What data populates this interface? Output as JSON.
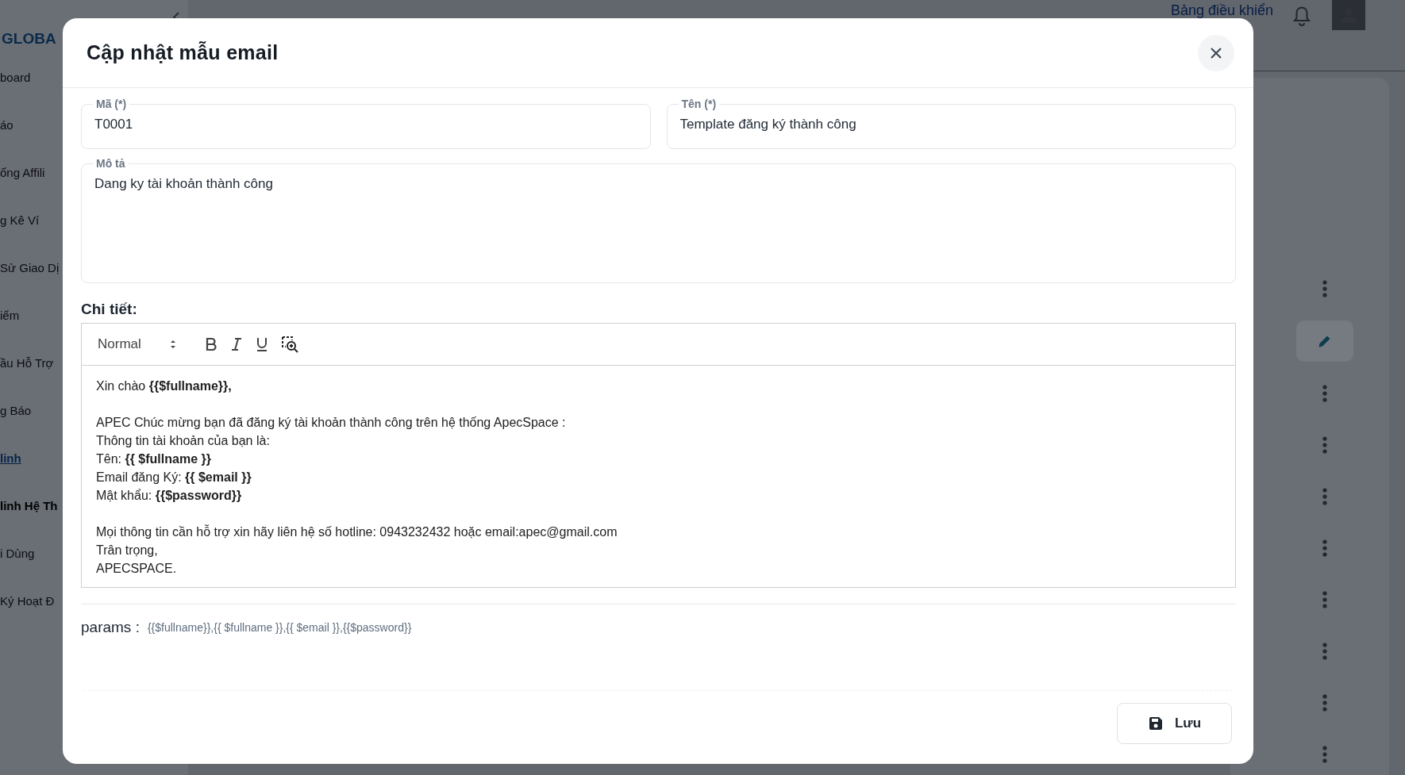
{
  "background": {
    "logo": "GLOBA",
    "header_link": "Bảng điều khiển",
    "sidebar_items": [
      {
        "label": "board",
        "kind": "item",
        "selected": false
      },
      {
        "label": "áo",
        "kind": "item",
        "selected": false
      },
      {
        "label": "ống Affili",
        "kind": "item",
        "selected": false
      },
      {
        "label": "g Kê Ví",
        "kind": "item",
        "selected": false
      },
      {
        "label": "Sử Giao Dị",
        "kind": "item",
        "selected": false
      },
      {
        "label": "iểm",
        "kind": "item",
        "selected": false
      },
      {
        "label": "ầu Hỗ Trợ",
        "kind": "item",
        "selected": false
      },
      {
        "label": "g Báo",
        "kind": "item",
        "selected": false
      },
      {
        "label": "linh",
        "kind": "item",
        "selected": true
      },
      {
        "label": "linh Hệ Th",
        "kind": "group",
        "selected": false
      },
      {
        "label": "i Dùng",
        "kind": "item",
        "selected": false
      },
      {
        "label": "Ký Hoạt Đ",
        "kind": "item",
        "selected": false
      }
    ],
    "row_actions": [
      {
        "kind": "menu"
      },
      {
        "kind": "edit"
      },
      {
        "kind": "menu"
      },
      {
        "kind": "menu"
      },
      {
        "kind": "menu"
      },
      {
        "kind": "menu"
      },
      {
        "kind": "menu"
      },
      {
        "kind": "menu"
      },
      {
        "kind": "menu"
      },
      {
        "kind": "menu"
      }
    ]
  },
  "modal": {
    "title": "Cập nhật mẫu email",
    "fields": [
      {
        "label": "Mã (*)",
        "value": "T0001"
      },
      {
        "label": "Tên (*)",
        "value": "Template đăng ký thành công"
      }
    ],
    "description": {
      "label": "Mô tả",
      "value": "Dang ky tài khoản thành công"
    },
    "detail_label": "Chi tiết:",
    "editor": {
      "format": "Normal",
      "paragraphs": [
        [
          "Xin chào **{{$fullname}},**"
        ],
        [
          "APEC Chúc mừng bạn đã đăng ký tài khoản thành công trên hệ thống ApecSpace :",
          "Thông tin tài khoản của bạn là:",
          "Tên: **{{ $fullname }}**",
          "Email đăng Ký: **{{ $email }}**",
          "Mật khẩu: **{{$password}}**"
        ],
        [
          "Mọi thông tin cần hỗ trợ xin hãy liên hệ số hotline: 0943232432 hoặc email:apec@gmail.com",
          "Trân trọng,",
          "APECSPACE."
        ]
      ]
    },
    "params_label": "params :",
    "params": "{{$fullname}},{{ $fullname }},{{ $email }},{{$password}}",
    "save_button": "Lưu"
  }
}
